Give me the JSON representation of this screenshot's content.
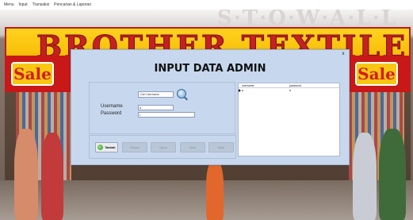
{
  "menu": {
    "items": [
      "Menu",
      "Input",
      "Transaksi",
      "Pencarian & Laporan"
    ]
  },
  "background": {
    "banner_text": "BROTHER TEXTILE",
    "sale_left": "Sale",
    "sale_right": "Sale"
  },
  "dialog": {
    "title": "INPUT DATA ADMIN",
    "close_label": "x",
    "search": {
      "value": "Cari Username",
      "icon": "search-icon"
    },
    "username": {
      "label": "Username",
      "value": "a"
    },
    "password": {
      "label": "Password",
      "value": "•"
    },
    "buttons": {
      "tambah": "Tambah",
      "simpan": "Simpan",
      "hapus": "Hapus",
      "ubah": "Ubah",
      "batal": "Batal"
    },
    "table": {
      "columns": [
        "username",
        "password"
      ],
      "rows": [
        [
          "a",
          "a"
        ]
      ]
    }
  },
  "colors": {
    "dialog_bg": "#c7d8ee",
    "disabled_button": "#b8c6d8",
    "banner_red": "#c62121",
    "banner_yellow": "#ffd21f"
  }
}
